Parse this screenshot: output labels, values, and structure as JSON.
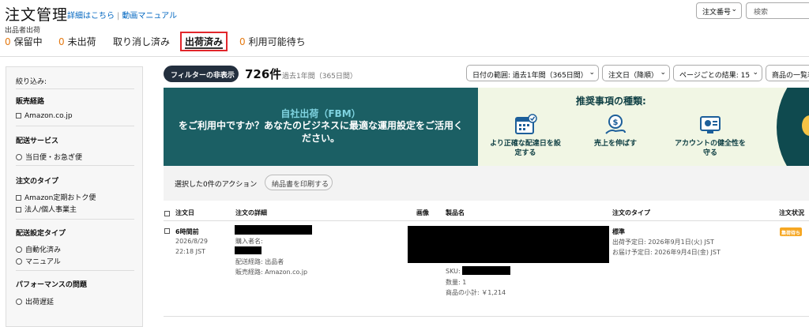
{
  "header": {
    "title": "注文管理",
    "links": [
      "詳細はこちら",
      "動画マニュアル"
    ],
    "subtitle": "出品者出荷",
    "order_select": "注文番号",
    "search_placeholder": "検索"
  },
  "tabs": [
    {
      "count": "0",
      "label": "保留中"
    },
    {
      "count": "0",
      "label": "未出荷"
    },
    {
      "count": "",
      "label": "取り消し済み"
    },
    {
      "count": "",
      "label": "出荷済み",
      "active": true
    },
    {
      "count": "0",
      "label": "利用可能待ち"
    }
  ],
  "sidebar": {
    "heading": "絞り込み:",
    "sections": [
      {
        "title": "販売経路",
        "type": "checkbox",
        "items": [
          "Amazon.co.jp"
        ]
      },
      {
        "title": "配送サービス",
        "type": "radio",
        "items": [
          "当日便・お急ぎ便"
        ]
      },
      {
        "title": "注文のタイプ",
        "type": "checkbox",
        "items": [
          "Amazon定期おトク便",
          "法人/個人事業主"
        ]
      },
      {
        "title": "配送設定タイプ",
        "type": "radio",
        "items": [
          "自動化済み",
          "マニュアル"
        ]
      },
      {
        "title": "パフォーマンスの問題",
        "type": "radio",
        "items": [
          "出荷遅延"
        ]
      }
    ]
  },
  "toolbar": {
    "filter_button": "フィルターの非表示",
    "count": "726件",
    "count_note": "過去1年間（365日間）",
    "date_range": "日付の範囲: 過去1年間（365日間）",
    "sort": "注文日（降順）",
    "per_page": "ページごとの結果: 15",
    "product": "商品の一覧表示"
  },
  "banner": {
    "title": "自社出荷（FBM）",
    "body": "をご利用中ですか？あなたのビジネスに最適な運用設定をご活用ください。",
    "rec_title": "推奨事項の種類:",
    "recs": [
      {
        "icon": "calendar-icon",
        "label": "より正確な配達日を設定する"
      },
      {
        "icon": "money-hand-icon",
        "label": "売上を伸ばす"
      },
      {
        "icon": "account-health-icon",
        "label": "アカウントの健全性を守る"
      }
    ],
    "colors": {
      "left": "#1b5f64",
      "right": "#f1f6e4",
      "accent": "#f6c344"
    }
  },
  "actions": {
    "selected_text": "選択した0件のアクション",
    "print_button": "納品書を印刷する"
  },
  "table": {
    "columns": [
      "注文日",
      "注文の詳細",
      "画像",
      "製品名",
      "注文のタイプ",
      "注文状況"
    ],
    "rows": [
      {
        "age": "6時間前",
        "date": "2026/8/29",
        "time": "22:18 JST",
        "buyer_label": "購入者名:",
        "ship_from": "配送経路: 出品者",
        "channel": "販売経路: Amazon.co.jp",
        "sku_label": "SKU:",
        "qty": "数量: 1",
        "subtotal": "商品の小計: ￥1,214",
        "order_type": "標準",
        "ship_by": "出荷予定日: 2026年9月1日(火) JST",
        "deliver_by": "お届け予定日: 2026年9月4日(金) JST",
        "status": "集荷待ち"
      }
    ]
  }
}
